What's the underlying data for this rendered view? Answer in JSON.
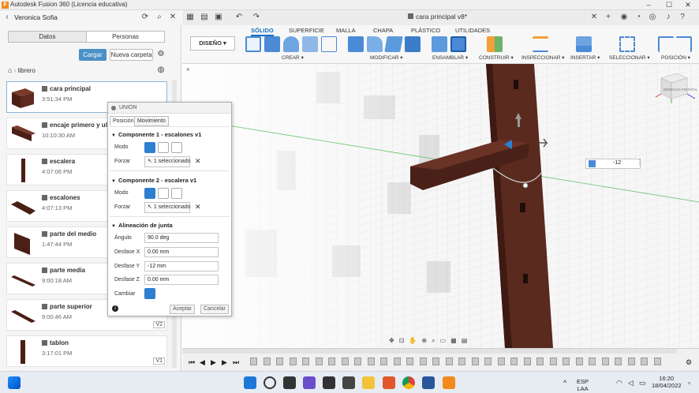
{
  "window": {
    "title": "Autodesk Fusion 360 (Licencia educativa)",
    "logo_letter": "F"
  },
  "data_panel": {
    "user": "Veronica Sofia",
    "tabs": [
      "Datos",
      "Personas"
    ],
    "upload_label": "Cargar",
    "new_folder_label": "Nueva carpeta",
    "breadcrumb": "librero",
    "files": [
      {
        "name": "cara principal",
        "time": "3:51:34 PM"
      },
      {
        "name": "encaje primero y ulti",
        "time": "10:10:30 AM"
      },
      {
        "name": "escalera",
        "time": "4:07:06 PM"
      },
      {
        "name": "escalones",
        "time": "4:07:13 PM"
      },
      {
        "name": "parte del medio",
        "time": "1:47:44 PM"
      },
      {
        "name": "parte media",
        "time": "9:00:18 AM"
      },
      {
        "name": "parte superior",
        "time": "9:00:46 AM",
        "version": "V2"
      },
      {
        "name": "tablon",
        "time": "3:17:01 PM",
        "version": "V1"
      }
    ]
  },
  "document": {
    "tab_title": "cara principal v8*"
  },
  "ribbon": {
    "tabs": [
      "SÓLIDO",
      "SUPERFICIE",
      "MALLA",
      "CHAPA",
      "PLÁSTICO",
      "UTILIDADES"
    ],
    "active_tab": "SÓLIDO",
    "workspace": "DISEÑO",
    "groups": [
      "CREAR",
      "MODIFICAR",
      "ENSAMBLAR",
      "CONSTRUIR",
      "INSPECCIONAR",
      "INSERTAR",
      "SELECCIONAR",
      "POSICIÓN"
    ]
  },
  "joint_dialog": {
    "title": "UNIÓN",
    "tabs": [
      "Posición",
      "Movimiento"
    ],
    "component1_header": "Componente 1 - escalones v1",
    "component2_header": "Componente 2 - escalera v1",
    "mode_label": "Modo",
    "snap_label": "Forzar",
    "selection_text": "1 seleccionado",
    "alignment_header": "Alineación de junta",
    "angle_label": "Ángulo",
    "angle_value": "90.0 deg",
    "offset_x_label": "Desfase X",
    "offset_x_value": "0.00 mm",
    "offset_y_label": "Desfase Y",
    "offset_y_value": "-12 mm",
    "offset_z_label": "Desfase Z",
    "offset_z_value": "0.00 mm",
    "flip_label": "Cambiar",
    "ok_label": "Aceptar",
    "cancel_label": "Cancelar"
  },
  "viewport": {
    "value_input": "-12",
    "viewcube_label": "DERECHA FRONTAL"
  },
  "taskbar": {
    "language": "ESP",
    "layout": "LAA",
    "time": "16:20",
    "date": "18/04/2022"
  },
  "colors": {
    "wood": "#5a2a1f",
    "accent_blue": "#1a6fc2",
    "upload_blue": "#4a90c7",
    "fusion_orange": "#f28a1c"
  }
}
